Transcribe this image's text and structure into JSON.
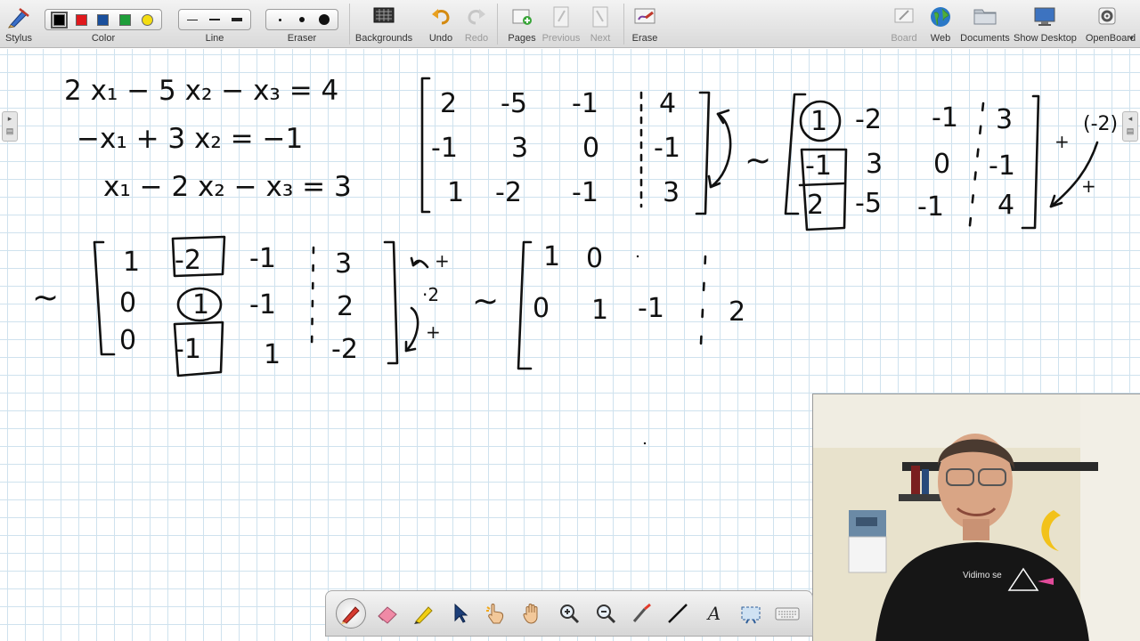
{
  "toolbar": {
    "stylus": "Stylus",
    "color": "Color",
    "line": "Line",
    "eraser": "Eraser",
    "backgrounds": "Backgrounds",
    "undo": "Undo",
    "redo": "Redo",
    "pages": "Pages",
    "previous": "Previous",
    "next": "Next",
    "erase": "Erase",
    "board": "Board",
    "web": "Web",
    "documents": "Documents",
    "show_desktop": "Show Desktop",
    "openboard": "OpenBoard"
  },
  "palette_colors": [
    "#000000",
    "#e0191d",
    "#1a4f9c",
    "#1f9e3a",
    "#f4dd12"
  ],
  "whiteboard": {
    "equations": {
      "eq1": "2 x₁ − 5 x₂ − x₃ = 4",
      "eq2": "−x₁ + 3 x₂ = −1",
      "eq3": "x₁ − 2 x₂ − x₃ = 3"
    },
    "matrix_a": {
      "rows": [
        [
          "2",
          "-5",
          "-1",
          "4"
        ],
        [
          "-1",
          "3",
          "0",
          "-1"
        ],
        [
          "1",
          "-2",
          "-1",
          "3"
        ]
      ]
    },
    "matrix_b": {
      "rows": [
        [
          "1",
          "-2",
          "-1",
          "3"
        ],
        [
          "-1",
          "3",
          "0",
          "-1"
        ],
        [
          "2",
          "-5",
          "-1",
          "4"
        ]
      ],
      "annotation": "(-2)",
      "plus": "+"
    },
    "matrix_c": {
      "rows": [
        [
          "1",
          "-2",
          "-1",
          "3"
        ],
        [
          "0",
          "1",
          "-1",
          "2"
        ],
        [
          "0",
          "-1",
          "1",
          "-2"
        ]
      ],
      "plus_top": "+",
      "multiplier": "·2",
      "plus_bottom": "+"
    },
    "matrix_d": {
      "row1": [
        "1",
        "0"
      ],
      "row2": [
        "0",
        "1",
        "-1",
        "2"
      ]
    },
    "tilde": "~"
  },
  "dock": {
    "text_tool": "A"
  }
}
